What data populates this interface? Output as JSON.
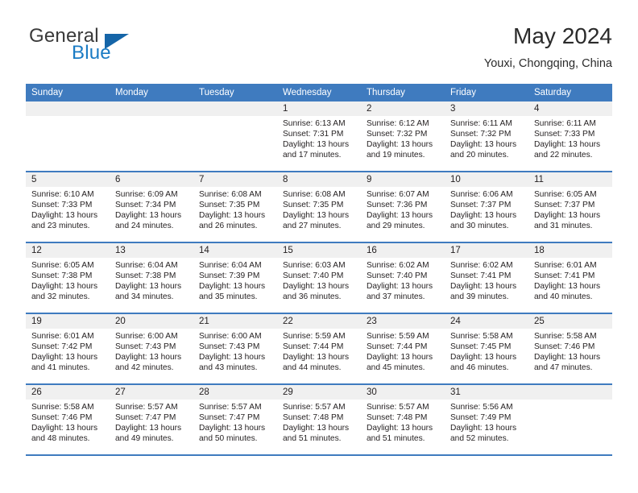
{
  "brand": {
    "word1": "General",
    "word2": "Blue",
    "triangle_icon": "triangle-icon",
    "colors": {
      "blue": "#1a7bc4",
      "triangle": "#1565a8",
      "dark": "#3a3a3a"
    }
  },
  "header": {
    "title": "May 2024",
    "subtitle": "Youxi, Chongqing, China"
  },
  "colors": {
    "header_bar": "#3f7bbf",
    "daynum_band": "#f0f0f0",
    "row_separator": "#3f7bbf",
    "text": "#231f20"
  },
  "weekdays": [
    "Sunday",
    "Monday",
    "Tuesday",
    "Wednesday",
    "Thursday",
    "Friday",
    "Saturday"
  ],
  "weeks": [
    [
      {
        "day": "",
        "empty": true
      },
      {
        "day": "",
        "empty": true
      },
      {
        "day": "",
        "empty": true
      },
      {
        "day": "1",
        "sunrise": "Sunrise: 6:13 AM",
        "sunset": "Sunset: 7:31 PM",
        "daylight1": "Daylight: 13 hours",
        "daylight2": "and 17 minutes."
      },
      {
        "day": "2",
        "sunrise": "Sunrise: 6:12 AM",
        "sunset": "Sunset: 7:32 PM",
        "daylight1": "Daylight: 13 hours",
        "daylight2": "and 19 minutes."
      },
      {
        "day": "3",
        "sunrise": "Sunrise: 6:11 AM",
        "sunset": "Sunset: 7:32 PM",
        "daylight1": "Daylight: 13 hours",
        "daylight2": "and 20 minutes."
      },
      {
        "day": "4",
        "sunrise": "Sunrise: 6:11 AM",
        "sunset": "Sunset: 7:33 PM",
        "daylight1": "Daylight: 13 hours",
        "daylight2": "and 22 minutes."
      }
    ],
    [
      {
        "day": "5",
        "sunrise": "Sunrise: 6:10 AM",
        "sunset": "Sunset: 7:33 PM",
        "daylight1": "Daylight: 13 hours",
        "daylight2": "and 23 minutes."
      },
      {
        "day": "6",
        "sunrise": "Sunrise: 6:09 AM",
        "sunset": "Sunset: 7:34 PM",
        "daylight1": "Daylight: 13 hours",
        "daylight2": "and 24 minutes."
      },
      {
        "day": "7",
        "sunrise": "Sunrise: 6:08 AM",
        "sunset": "Sunset: 7:35 PM",
        "daylight1": "Daylight: 13 hours",
        "daylight2": "and 26 minutes."
      },
      {
        "day": "8",
        "sunrise": "Sunrise: 6:08 AM",
        "sunset": "Sunset: 7:35 PM",
        "daylight1": "Daylight: 13 hours",
        "daylight2": "and 27 minutes."
      },
      {
        "day": "9",
        "sunrise": "Sunrise: 6:07 AM",
        "sunset": "Sunset: 7:36 PM",
        "daylight1": "Daylight: 13 hours",
        "daylight2": "and 29 minutes."
      },
      {
        "day": "10",
        "sunrise": "Sunrise: 6:06 AM",
        "sunset": "Sunset: 7:37 PM",
        "daylight1": "Daylight: 13 hours",
        "daylight2": "and 30 minutes."
      },
      {
        "day": "11",
        "sunrise": "Sunrise: 6:05 AM",
        "sunset": "Sunset: 7:37 PM",
        "daylight1": "Daylight: 13 hours",
        "daylight2": "and 31 minutes."
      }
    ],
    [
      {
        "day": "12",
        "sunrise": "Sunrise: 6:05 AM",
        "sunset": "Sunset: 7:38 PM",
        "daylight1": "Daylight: 13 hours",
        "daylight2": "and 32 minutes."
      },
      {
        "day": "13",
        "sunrise": "Sunrise: 6:04 AM",
        "sunset": "Sunset: 7:38 PM",
        "daylight1": "Daylight: 13 hours",
        "daylight2": "and 34 minutes."
      },
      {
        "day": "14",
        "sunrise": "Sunrise: 6:04 AM",
        "sunset": "Sunset: 7:39 PM",
        "daylight1": "Daylight: 13 hours",
        "daylight2": "and 35 minutes."
      },
      {
        "day": "15",
        "sunrise": "Sunrise: 6:03 AM",
        "sunset": "Sunset: 7:40 PM",
        "daylight1": "Daylight: 13 hours",
        "daylight2": "and 36 minutes."
      },
      {
        "day": "16",
        "sunrise": "Sunrise: 6:02 AM",
        "sunset": "Sunset: 7:40 PM",
        "daylight1": "Daylight: 13 hours",
        "daylight2": "and 37 minutes."
      },
      {
        "day": "17",
        "sunrise": "Sunrise: 6:02 AM",
        "sunset": "Sunset: 7:41 PM",
        "daylight1": "Daylight: 13 hours",
        "daylight2": "and 39 minutes."
      },
      {
        "day": "18",
        "sunrise": "Sunrise: 6:01 AM",
        "sunset": "Sunset: 7:41 PM",
        "daylight1": "Daylight: 13 hours",
        "daylight2": "and 40 minutes."
      }
    ],
    [
      {
        "day": "19",
        "sunrise": "Sunrise: 6:01 AM",
        "sunset": "Sunset: 7:42 PM",
        "daylight1": "Daylight: 13 hours",
        "daylight2": "and 41 minutes."
      },
      {
        "day": "20",
        "sunrise": "Sunrise: 6:00 AM",
        "sunset": "Sunset: 7:43 PM",
        "daylight1": "Daylight: 13 hours",
        "daylight2": "and 42 minutes."
      },
      {
        "day": "21",
        "sunrise": "Sunrise: 6:00 AM",
        "sunset": "Sunset: 7:43 PM",
        "daylight1": "Daylight: 13 hours",
        "daylight2": "and 43 minutes."
      },
      {
        "day": "22",
        "sunrise": "Sunrise: 5:59 AM",
        "sunset": "Sunset: 7:44 PM",
        "daylight1": "Daylight: 13 hours",
        "daylight2": "and 44 minutes."
      },
      {
        "day": "23",
        "sunrise": "Sunrise: 5:59 AM",
        "sunset": "Sunset: 7:44 PM",
        "daylight1": "Daylight: 13 hours",
        "daylight2": "and 45 minutes."
      },
      {
        "day": "24",
        "sunrise": "Sunrise: 5:58 AM",
        "sunset": "Sunset: 7:45 PM",
        "daylight1": "Daylight: 13 hours",
        "daylight2": "and 46 minutes."
      },
      {
        "day": "25",
        "sunrise": "Sunrise: 5:58 AM",
        "sunset": "Sunset: 7:46 PM",
        "daylight1": "Daylight: 13 hours",
        "daylight2": "and 47 minutes."
      }
    ],
    [
      {
        "day": "26",
        "sunrise": "Sunrise: 5:58 AM",
        "sunset": "Sunset: 7:46 PM",
        "daylight1": "Daylight: 13 hours",
        "daylight2": "and 48 minutes."
      },
      {
        "day": "27",
        "sunrise": "Sunrise: 5:57 AM",
        "sunset": "Sunset: 7:47 PM",
        "daylight1": "Daylight: 13 hours",
        "daylight2": "and 49 minutes."
      },
      {
        "day": "28",
        "sunrise": "Sunrise: 5:57 AM",
        "sunset": "Sunset: 7:47 PM",
        "daylight1": "Daylight: 13 hours",
        "daylight2": "and 50 minutes."
      },
      {
        "day": "29",
        "sunrise": "Sunrise: 5:57 AM",
        "sunset": "Sunset: 7:48 PM",
        "daylight1": "Daylight: 13 hours",
        "daylight2": "and 51 minutes."
      },
      {
        "day": "30",
        "sunrise": "Sunrise: 5:57 AM",
        "sunset": "Sunset: 7:48 PM",
        "daylight1": "Daylight: 13 hours",
        "daylight2": "and 51 minutes."
      },
      {
        "day": "31",
        "sunrise": "Sunrise: 5:56 AM",
        "sunset": "Sunset: 7:49 PM",
        "daylight1": "Daylight: 13 hours",
        "daylight2": "and 52 minutes."
      },
      {
        "day": "",
        "empty": true
      }
    ]
  ]
}
